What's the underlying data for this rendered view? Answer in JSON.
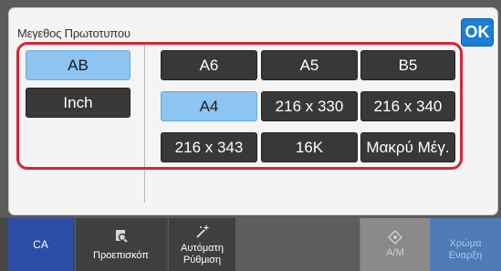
{
  "title": "Μεγεθος Πρωτοτυπου",
  "ok_label": "OK",
  "units": [
    {
      "label": "AB",
      "selected": true
    },
    {
      "label": "Inch",
      "selected": false
    }
  ],
  "sizes": [
    {
      "label": "A6",
      "selected": false
    },
    {
      "label": "A5",
      "selected": false
    },
    {
      "label": "B5",
      "selected": false
    },
    {
      "label": "A4",
      "selected": true
    },
    {
      "label": "216 x 330",
      "selected": false
    },
    {
      "label": "216 x 340",
      "selected": false
    },
    {
      "label": "216 x 343",
      "selected": false
    },
    {
      "label": "16K",
      "selected": false
    },
    {
      "label": "Μακρύ Μέγ.",
      "selected": false
    }
  ],
  "bottom_bar": {
    "ca_label": "CA",
    "preview_label": "Προεπισκόπ",
    "auto_label_1": "Αυτόματη",
    "auto_label_2": "Ρύθμιση",
    "bw_label": "Α/Μ",
    "color_label_1": "Χρώμα",
    "color_label_2": "Εναρξη"
  },
  "colors": {
    "accent": "#1a7fd8",
    "selected_button": "#8dc4f0",
    "highlight_border": "#d9223a",
    "ca_button": "#2c4da8"
  },
  "icons": [
    "magnifier-icon",
    "sparkle-wand-icon",
    "start-icon"
  ]
}
